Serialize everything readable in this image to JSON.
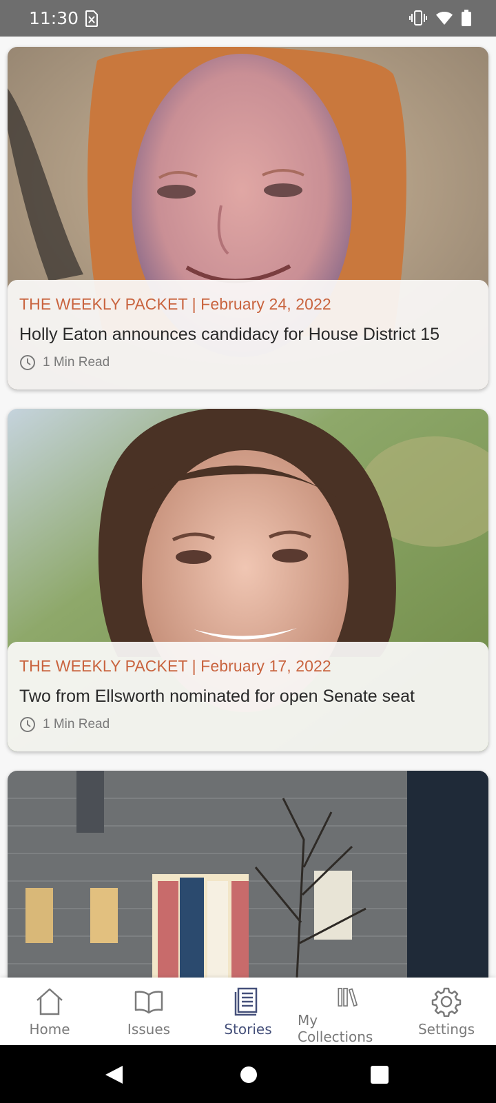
{
  "status_bar": {
    "time": "11:30",
    "icons": [
      "sim-card-alert-icon",
      "vibrate-icon",
      "wifi-icon",
      "battery-icon"
    ]
  },
  "stories": [
    {
      "source": "THE WEEKLY PACKET | February 24, 2022",
      "title": "Holly Eaton announces candidacy for House District 15",
      "read_time": "1 Min Read",
      "image": "portrait-red-haired-woman"
    },
    {
      "source": "THE WEEKLY PACKET | February 17, 2022",
      "title": "Two from Ellsworth nominated for open Senate seat",
      "read_time": "1 Min Read",
      "image": "portrait-curly-haired-woman"
    },
    {
      "image": "house-at-night"
    }
  ],
  "bottom_nav": {
    "items": [
      {
        "label": "Home",
        "icon": "home-icon"
      },
      {
        "label": "Issues",
        "icon": "book-icon"
      },
      {
        "label": "Stories",
        "icon": "newspaper-icon",
        "active": true
      },
      {
        "label": "My Collections",
        "icon": "library-icon"
      },
      {
        "label": "Settings",
        "icon": "gear-icon"
      }
    ]
  },
  "colors": {
    "accent_source": "#c9643f",
    "nav_active": "#45507a",
    "nav_inactive": "#7a7a7a",
    "status_bar": "#6e6e6e"
  }
}
